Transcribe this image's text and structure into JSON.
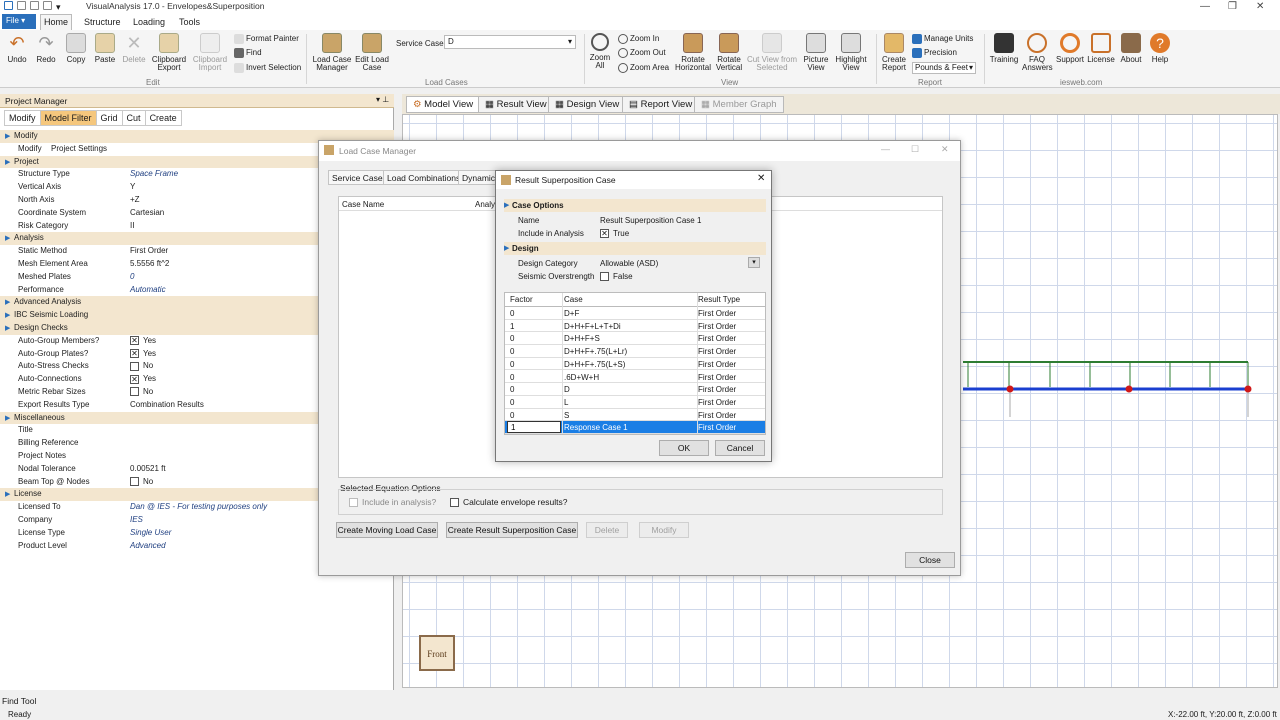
{
  "window": {
    "title": "VisualAnalysis 17.0 - Envelopes&Superposition"
  },
  "ribbon_tabs": {
    "file": "File",
    "home": "Home",
    "structure": "Structure",
    "loading": "Loading",
    "tools": "Tools"
  },
  "ribbon": {
    "undo": "Undo",
    "redo": "Redo",
    "copy": "Copy",
    "paste": "Paste",
    "delete": "Delete",
    "clipboard_export": "Clipboard Export",
    "clipboard_import": "Clipboard Import",
    "format_painter": "Format Painter",
    "find": "Find",
    "invert_selection": "Invert Selection",
    "edit_group": "Edit",
    "load_case_manager": "Load Case Manager",
    "edit_load_case": "Edit Load Case",
    "service_case_label": "Service Case",
    "service_case_value": "D",
    "load_cases_group": "Load Cases",
    "zoom_all": "Zoom All",
    "zoom_in": "Zoom In",
    "zoom_out": "Zoom Out",
    "zoom_area": "Zoom Area",
    "rotate_horizontal": "Rotate Horizontal",
    "rotate_vertical": "Rotate Vertical",
    "cut_view": "Cut View from Selected",
    "picture_view": "Picture View",
    "highlight_view": "Highlight View",
    "view_group": "View",
    "create_report": "Create Report",
    "manage_units": "Manage Units",
    "precision": "Precision",
    "units_value": "Pounds & Feet",
    "report_group": "Report",
    "training": "Training",
    "faq_answers": "FAQ Answers",
    "support": "Support",
    "license": "License",
    "about": "About",
    "help": "Help",
    "iesweb_group": "iesweb.com"
  },
  "project_manager": {
    "title": "Project Manager",
    "tabs": [
      "Modify",
      "Model Filter",
      "Grid",
      "Cut",
      "Create"
    ],
    "rows": [
      {
        "type": "sec",
        "k": "Modify"
      },
      {
        "type": "row",
        "k": "Modify",
        "v": "Project Settings",
        "vx": "51"
      },
      {
        "type": "sec",
        "k": "Project"
      },
      {
        "type": "row",
        "k": "Structure Type",
        "v": "Space Frame",
        "it": true
      },
      {
        "type": "row",
        "k": "Vertical Axis",
        "v": "Y"
      },
      {
        "type": "row",
        "k": "North Axis",
        "v": "+Z"
      },
      {
        "type": "row",
        "k": "Coordinate System",
        "v": "Cartesian"
      },
      {
        "type": "row",
        "k": "Risk Category",
        "v": "II"
      },
      {
        "type": "sec",
        "k": "Analysis"
      },
      {
        "type": "row",
        "k": "Static Method",
        "v": "First Order"
      },
      {
        "type": "row",
        "k": "Mesh Element Area",
        "v": "5.5556 ft^2"
      },
      {
        "type": "row",
        "k": "Meshed Plates",
        "v": "0",
        "it": true
      },
      {
        "type": "row",
        "k": "Performance",
        "v": "Automatic",
        "it": true
      },
      {
        "type": "sec",
        "k": "Advanced Analysis"
      },
      {
        "type": "sec",
        "k": "IBC Seismic Loading"
      },
      {
        "type": "sec",
        "k": "Design Checks"
      },
      {
        "type": "row",
        "k": "Auto-Group Members?",
        "v": "Yes",
        "cb": true,
        "checked": true
      },
      {
        "type": "row",
        "k": "Auto-Group Plates?",
        "v": "Yes",
        "cb": true,
        "checked": true
      },
      {
        "type": "row",
        "k": "Auto-Stress Checks",
        "v": "No",
        "cb": true,
        "checked": false
      },
      {
        "type": "row",
        "k": "Auto-Connections",
        "v": "Yes",
        "cb": true,
        "checked": true
      },
      {
        "type": "row",
        "k": "Metric Rebar Sizes",
        "v": "No",
        "cb": true,
        "checked": false
      },
      {
        "type": "row",
        "k": "Export Results Type",
        "v": "Combination Results"
      },
      {
        "type": "sec",
        "k": "Miscellaneous"
      },
      {
        "type": "row",
        "k": "Title",
        "v": ""
      },
      {
        "type": "row",
        "k": "Billing Reference",
        "v": ""
      },
      {
        "type": "row",
        "k": "Project Notes",
        "v": ""
      },
      {
        "type": "row",
        "k": "Nodal Tolerance",
        "v": "0.00521 ft"
      },
      {
        "type": "row",
        "k": "Beam Top @ Nodes",
        "v": "No",
        "cb": true,
        "checked": false
      },
      {
        "type": "sec",
        "k": "License"
      },
      {
        "type": "row",
        "k": "Licensed To",
        "v": "Dan @ IES - For testing purposes only",
        "it": true
      },
      {
        "type": "row",
        "k": "Company",
        "v": "IES",
        "it": true
      },
      {
        "type": "row",
        "k": "License Type",
        "v": "Single User",
        "it": true
      },
      {
        "type": "row",
        "k": "Product Level",
        "v": "Advanced",
        "it": true
      }
    ]
  },
  "view_tabs": [
    "Model View",
    "Result View",
    "Design View",
    "Report View",
    "Member Graph"
  ],
  "front_label": "Front",
  "find_tool": "Find Tool",
  "status": {
    "left": "Ready",
    "coords": "X:-22.00 ft, Y:20.00 ft, Z:0.00 ft"
  },
  "load_case_manager": {
    "title": "Load Case Manager",
    "tabs": [
      "Service Cases",
      "Load Combinations",
      "Dynamic"
    ],
    "col_case_name": "Case Name",
    "col_analysis": "Analy",
    "selected_eq_options": "Selected Equation Options",
    "include_in_analysis": "Include in analysis?",
    "calc_envelope": "Calculate envelope results?",
    "buttons": {
      "moving": "Create Moving Load Case",
      "superposition": "Create Result Superposition Case",
      "delete": "Delete",
      "modify": "Modify",
      "close": "Close"
    }
  },
  "rsc_dialog": {
    "title": "Result Superposition Case",
    "case_options": "Case Options",
    "name_label": "Name",
    "name_value": "Result Superposition Case 1",
    "include_label": "Include in Analysis",
    "include_value": "True",
    "design": "Design",
    "design_category_label": "Design Category",
    "design_category_value": "Allowable (ASD)",
    "seismic_label": "Seismic Overstrength",
    "seismic_value": "False",
    "headers": {
      "factor": "Factor",
      "case": "Case",
      "result_type": "Result Type"
    },
    "rows": [
      {
        "factor": "0",
        "case": "D+F",
        "type": "First Order"
      },
      {
        "factor": "1",
        "case": "D+H+F+L+T+Di",
        "type": "First Order"
      },
      {
        "factor": "0",
        "case": "D+H+F+S",
        "type": "First Order"
      },
      {
        "factor": "0",
        "case": "D+H+F+.75(L+Lr)",
        "type": "First Order"
      },
      {
        "factor": "0",
        "case": "D+H+F+.75(L+S)",
        "type": "First Order"
      },
      {
        "factor": "0",
        "case": ".6D+W+H",
        "type": "First Order"
      },
      {
        "factor": "0",
        "case": "D",
        "type": "First Order"
      },
      {
        "factor": "0",
        "case": "L",
        "type": "First Order"
      },
      {
        "factor": "0",
        "case": "S",
        "type": "First Order"
      },
      {
        "factor": "1",
        "case": "Response Case 1",
        "type": "First Order",
        "selected": true
      }
    ],
    "ok": "OK",
    "cancel": "Cancel"
  }
}
